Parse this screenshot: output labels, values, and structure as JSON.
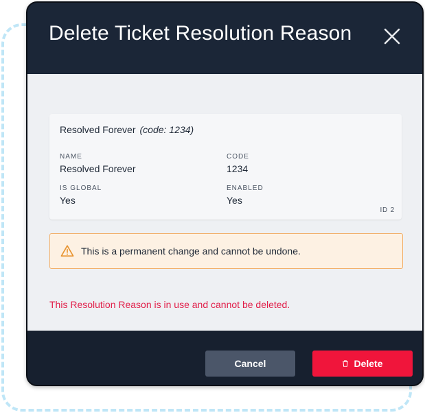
{
  "modal": {
    "title": "Delete Ticket Resolution Reason",
    "close_icon": "close-icon"
  },
  "card": {
    "heading_name": "Resolved Forever",
    "heading_code": "(code: 1234)",
    "fields": [
      {
        "label": "NAME",
        "value": "Resolved Forever"
      },
      {
        "label": "CODE",
        "value": "1234"
      },
      {
        "label": "IS GLOBAL",
        "value": "Yes"
      },
      {
        "label": "ENABLED",
        "value": "Yes"
      }
    ],
    "id_tag": "ID 2"
  },
  "warning": {
    "icon": "warning-triangle-icon",
    "text": "This is a permanent change and cannot be undone."
  },
  "error": {
    "text": "This Resolution Reason is in use and cannot be deleted."
  },
  "footer": {
    "cancel_label": "Cancel",
    "delete_label": "Delete",
    "delete_icon": "trash-icon"
  },
  "colors": {
    "header_bg": "#1b2637",
    "body_bg": "#eef0f3",
    "warning_border": "#f2b06a",
    "warning_bg": "#fdf1e3",
    "error_text": "#e11d48",
    "delete_button": "#f0153b",
    "cancel_button": "#4b5669"
  }
}
